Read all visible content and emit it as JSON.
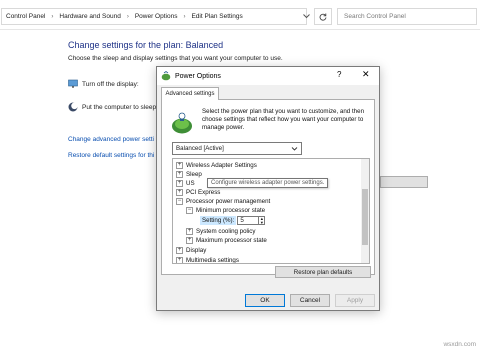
{
  "address_bar": {
    "crumbs": [
      "Control Panel",
      "Hardware and Sound",
      "Power Options",
      "Edit Plan Settings"
    ],
    "search_placeholder": "Search Control Panel"
  },
  "main": {
    "heading": "Change settings for the plan: Balanced",
    "subtitle": "Choose the sleep and display settings that you want your computer to use.",
    "turn_off_display": "Turn off the display:",
    "sleep": "Put the computer to sleep",
    "link_advanced": "Change advanced power setti",
    "link_restore": "Restore default settings for thi"
  },
  "dialog": {
    "title": "Power Options",
    "help_glyph": "?",
    "close_glyph": "✕",
    "tab": "Advanced settings",
    "intro": "Select the power plan that you want to customize, and then choose settings that reflect how you want your computer to manage power.",
    "plan_selected": "Balanced [Active]",
    "tree": {
      "wireless": "Wireless Adapter Settings",
      "sleep": "Sleep",
      "usb": "US",
      "pci": "PCI Express",
      "ppm": "Processor power management",
      "min_state": "Minimum processor state",
      "setting_label": "Setting (%):",
      "setting_value": "5",
      "cooling": "System cooling policy",
      "max_state": "Maximum processor state",
      "display": "Display",
      "multimedia": "Multimedia settings"
    },
    "tooltip": "Configure wireless adapter power settings.",
    "restore_button": "Restore plan defaults",
    "ok": "OK",
    "cancel": "Cancel",
    "apply": "Apply"
  },
  "watermark": "wsxdn.com"
}
